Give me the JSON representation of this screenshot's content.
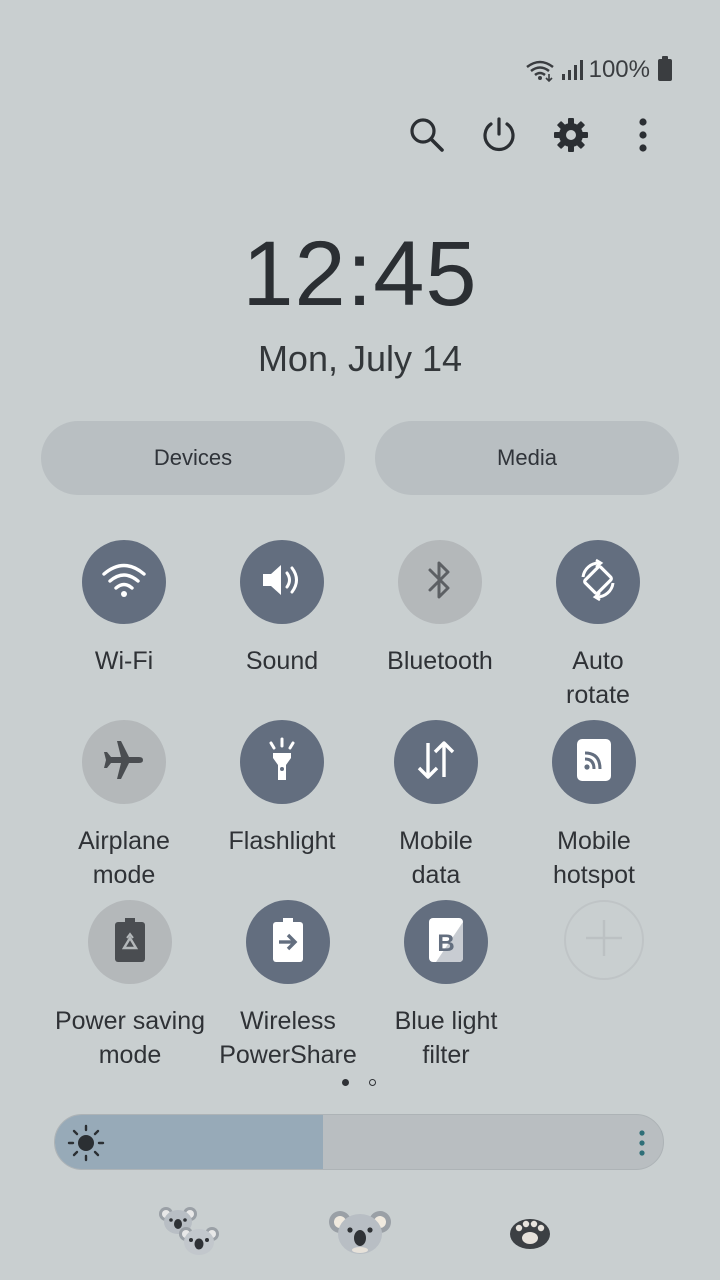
{
  "status": {
    "battery_text": "100%",
    "icons": [
      "wifi-icon",
      "signal-icon",
      "battery-icon"
    ]
  },
  "top_actions": [
    "search-icon",
    "power-icon",
    "settings-icon",
    "more-vert-icon"
  ],
  "clock": {
    "time": "12:45",
    "date": "Mon, July 14"
  },
  "pills": {
    "devices": "Devices",
    "media": "Media"
  },
  "tiles": [
    {
      "label": "Wi-Fi",
      "icon": "wifi-icon",
      "state": "on"
    },
    {
      "label": "Sound",
      "icon": "volume-icon",
      "state": "on"
    },
    {
      "label": "Bluetooth",
      "icon": "bluetooth-icon",
      "state": "off"
    },
    {
      "label": "Auto\nrotate",
      "icon": "auto-rotate-icon",
      "state": "on"
    },
    {
      "label": "Airplane\nmode",
      "icon": "airplane-icon",
      "state": "off"
    },
    {
      "label": "Flashlight",
      "icon": "flashlight-icon",
      "state": "on"
    },
    {
      "label": "Mobile\ndata",
      "icon": "mobile-data-icon",
      "state": "on"
    },
    {
      "label": "Mobile\nhotspot",
      "icon": "hotspot-icon",
      "state": "on"
    },
    {
      "label": "Power saving\nmode",
      "icon": "power-saving-icon",
      "state": "off"
    },
    {
      "label": "Wireless\nPowerShare",
      "icon": "wireless-powershare-icon",
      "state": "on"
    },
    {
      "label": "Blue light\nfilter",
      "icon": "blue-light-filter-icon",
      "state": "on"
    },
    {
      "label": "",
      "icon": "add-icon",
      "state": "add"
    }
  ],
  "pager": {
    "pages": 2,
    "current": 1
  },
  "brightness": {
    "level": 0.44
  },
  "colors": {
    "background": "#c9cfd0",
    "tile_on": "#636e7f",
    "tile_off": "#b4b8ba",
    "brightness_fill": "#97aab8",
    "more_dots": "#2f6f78"
  },
  "bottom_apps": [
    "koala-pair-icon",
    "koala-face-icon",
    "paw-icon"
  ]
}
